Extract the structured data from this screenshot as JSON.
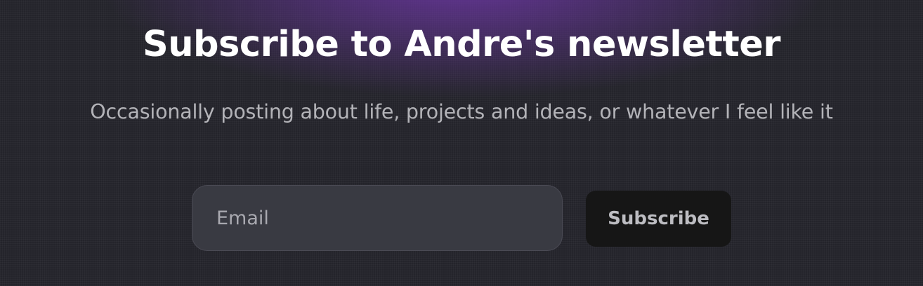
{
  "newsletter": {
    "title": "Subscribe to Andre's newsletter",
    "subtitle": "Occasionally posting about life, projects and ideas, or whatever I feel like it",
    "email_placeholder": "Email",
    "email_value": "",
    "subscribe_label": "Subscribe"
  },
  "colors": {
    "background": "#24242b",
    "glow": "#7038aa",
    "title": "#ffffff",
    "subtitle": "#b3b3b8",
    "input_bg": "#393a42",
    "button_bg": "#161616",
    "button_text": "#bdbdc2"
  }
}
